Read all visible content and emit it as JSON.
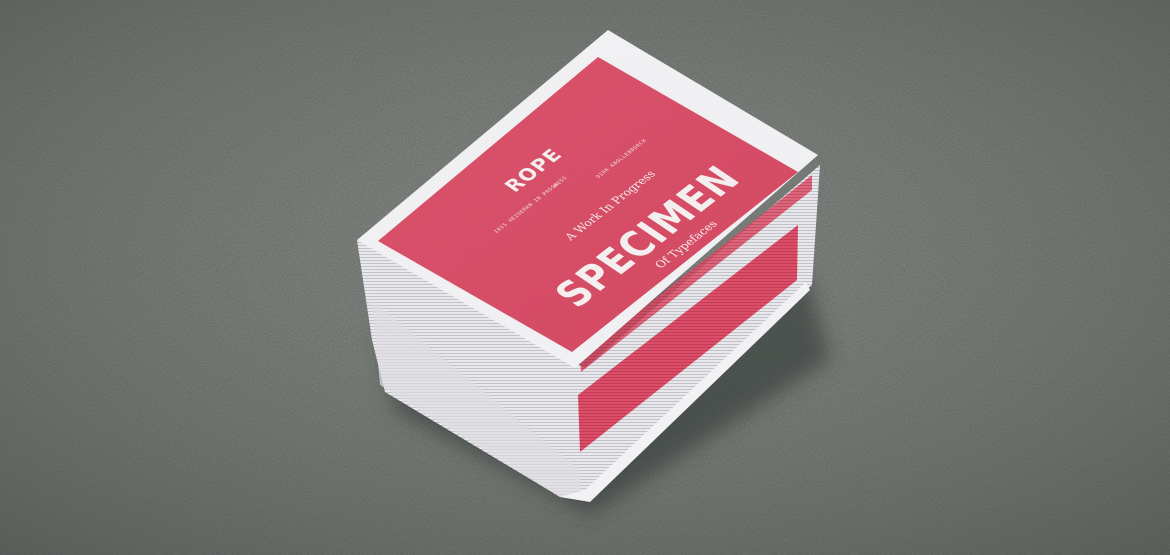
{
  "cover": {
    "brand": "ROPE",
    "left_small_text": "IRIS HEIDEMAN IN PROGRESS",
    "right_small_text": "DIRK KNOLLENBORCH",
    "mark": "≈",
    "tagline": "A Work In Progress",
    "headline": "SPECIMEN",
    "subline": "Of Typefaces"
  },
  "colors": {
    "floor": "#646a64",
    "cover_pink": "#d9455f",
    "paper": "#eeeef0",
    "edge_pink": "#d03a55"
  }
}
